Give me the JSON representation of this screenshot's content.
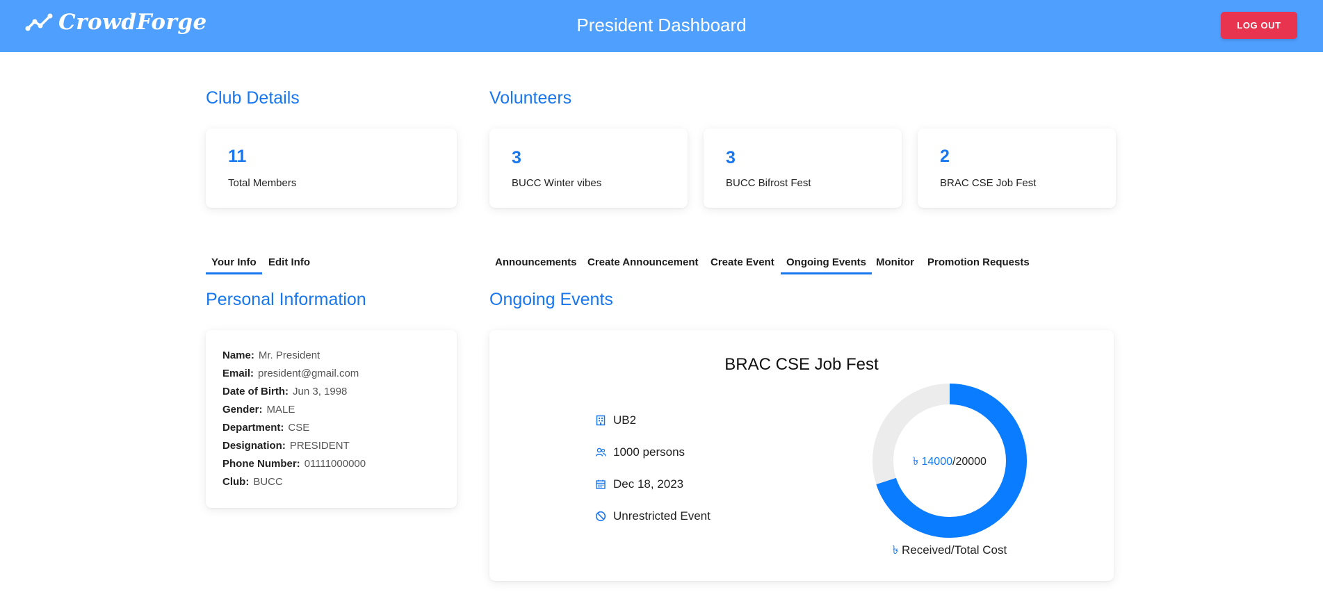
{
  "header": {
    "logo_text": "CrowdForge",
    "title": "President Dashboard",
    "logout_label": "LOG OUT",
    "bg_color": "#4f9fff"
  },
  "club_details": {
    "heading": "Club Details",
    "total_members": {
      "value": "11",
      "label": "Total Members"
    }
  },
  "volunteers": {
    "heading": "Volunteers",
    "items": [
      {
        "value": "3",
        "label": "BUCC Winter vibes"
      },
      {
        "value": "3",
        "label": "BUCC Bifrost Fest"
      },
      {
        "value": "2",
        "label": "BRAC CSE Job Fest"
      }
    ]
  },
  "left_tabs": [
    {
      "label": "Your Info",
      "active": true
    },
    {
      "label": "Edit Info",
      "active": false
    }
  ],
  "right_tabs": [
    {
      "label": "Announcements",
      "active": false
    },
    {
      "label": "Create Announcement",
      "active": false
    },
    {
      "label": "Create Event",
      "active": false
    },
    {
      "label": "Ongoing Events",
      "active": true
    },
    {
      "label": "Monitor",
      "active": false
    },
    {
      "label": "Promotion Requests",
      "active": false
    }
  ],
  "personal_info": {
    "heading": "Personal Information",
    "rows": [
      {
        "key": "Name:",
        "value": "Mr. President"
      },
      {
        "key": "Email:",
        "value": "president@gmail.com"
      },
      {
        "key": "Date of Birth:",
        "value": "Jun 3, 1998"
      },
      {
        "key": "Gender:",
        "value": "MALE"
      },
      {
        "key": "Department:",
        "value": "CSE"
      },
      {
        "key": "Designation:",
        "value": "PRESIDENT"
      },
      {
        "key": "Phone Number:",
        "value": "01111000000"
      },
      {
        "key": "Club:",
        "value": "BUCC"
      }
    ]
  },
  "ongoing_events": {
    "heading": "Ongoing Events",
    "event": {
      "title": "BRAC CSE Job Fest",
      "venue": "UB2",
      "capacity": "1000 persons",
      "date": "Dec 18, 2023",
      "restriction": "Unrestricted Event",
      "currency": "৳",
      "received": "14000",
      "total": "/20000",
      "received_value": 14000,
      "total_value": 20000,
      "caption": "Received/Total Cost",
      "donut_fill_color": "#0a7cff",
      "donut_track_color": "#ececec"
    }
  }
}
